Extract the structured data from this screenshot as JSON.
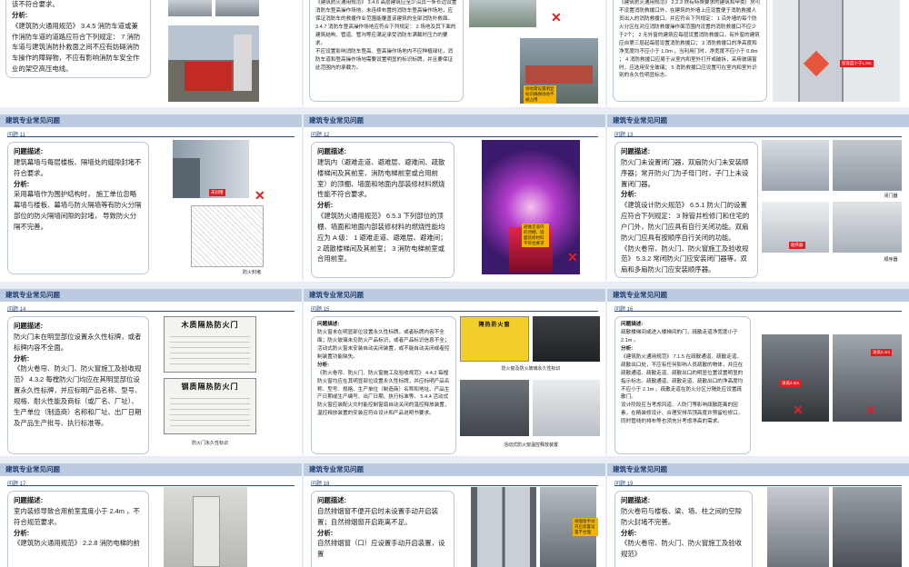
{
  "header": "建筑专业常见问题",
  "colors": {
    "band": "#bccbe0",
    "header_text": "#1f3f74",
    "card_border": "#b9c7dc",
    "x_mark": "#e02020"
  },
  "s1": {
    "l": [
      "该不符合要求。",
      "分析:"
    ]
  },
  "s2": {
    "p": "《建筑防火通用规范》 3.4.6 高层建筑应至少沿其一条长边设置消防车登高操作场地。未连续布置的消防车登高操作场地，应保证消防车的救援作业范围能覆盖该建筑的全部消防扑救面。 3.4.7 消防车登高操作场地应符合下列规定： 2 场地及其下面的建筑结构、管道、管沟等应满足承受消防车满载时压力的要求。",
    "p2": "不应设置影响消防车登高、登高操作场地内不应种植绿化，消防车道和登高操作场地需要设置明显的标识标牌，并且要保证此范围内的承载力。",
    "tag": "场地需设置明显标识确保场地不被占用",
    "x": "✕"
  },
  "s3": {
    "p": "《建筑防火通用规范》 2.2.3 除有特殊要求的建筑和甲类厂房可不设置消防救援口外，在建筑的外墙上应设置便于消防救援人员出入的消防救援口，并应符合下列规定： 1 沿外墙的每个防火分区在对应消防救援操作面范围内设置的消防救援口不应少于2个； 2 无外窗的建筑应每层设置消防救援口，有外窗的建筑应自第三层起每层设置消防救援口； 3 消防救援口的净高度和净宽度均不应小于 1.0m ，当利用门时，净宽度不应小于 0.8m ； 4 消防救援口应易于从室内和室外打开或破拆，采用玻璃窗时，应选用安全玻璃； 5 消防救援口应设置可在室内和室外识别的永久性明显标志。",
    "tag": "窗宽度小于1.0m"
  },
  "s11": {
    "num": "问题 11",
    "lines": [
      {
        "c": "h",
        "t": "问题描述:"
      },
      {
        "c": "t",
        "t": "建筑幕墙与每层楼板、隔墙处的缝隙封堵不符合要求。"
      },
      {
        "c": "h",
        "t": "分析:"
      },
      {
        "c": "t",
        "t": "采用幕墙作为围护结构时， 施工单位忽略幕墙与楼板、幕墙与防火隔墙等有防火分隔部位的防火隔墙间隙的封堵， 导致防火分隔不完善。"
      }
    ],
    "tag": "未封堵",
    "x": "✕",
    "cap": "防火封堵"
  },
  "s12": {
    "num": "问题 12",
    "lines": [
      {
        "c": "h",
        "t": "问题描述:"
      },
      {
        "c": "t",
        "t": "建筑内（避难走道、避难层、避难间、疏散楼梯间及其前室、消防电梯前室或合用前室）的顶棚、墙面和地面内部装修材料燃烧性能不符合要求。"
      },
      {
        "c": "h",
        "t": "分析:"
      },
      {
        "c": "t",
        "t": "《建筑防火通用规范》 6.5.3 下列部位的顶棚、墙面和地面内部装修材料的燃烧性能均应为 A 级： 1 避难走道、避难层、避难间； 2 疏散楼梯间及其前室； 3 消防电梯前室或合用前室。"
      }
    ],
    "tag": "避难走道内的顶棚、墙面装修材料不符合要求",
    "x": "✕"
  },
  "s13": {
    "num": "问题 13",
    "lines": [
      {
        "c": "h",
        "t": "问题描述:"
      },
      {
        "c": "t",
        "t": "防火门未设置闭门器，双扇防火门未安装顺序器；常开防火门为子母门时，子门上未设置闭门器。"
      },
      {
        "c": "h",
        "t": "分析:"
      },
      {
        "c": "t",
        "t": "《建筑设计防火规范》 6.5.1 防火门的设置应符合下列规定： 3 除管井检修门和住宅的户门外，防火门应具有自行关闭功能。双扇防火门应具有按顺序自行关闭的功能。"
      },
      {
        "c": "t",
        "t": "《防火卷帘、防火门、防火窗施工及验收规范》 5.3.2 常闭防火门应安装闭门器等，双扇和多扇防火门应安装顺序器。"
      }
    ],
    "cap1": "闭门器",
    "cap2": "顺序器",
    "tag": "顺序器"
  },
  "s14": {
    "num": "问题 14",
    "lines": [
      {
        "c": "h",
        "t": "问题描述:"
      },
      {
        "c": "t",
        "t": "防火门未在明显部位设置永久性标牌，或者标牌内容不全面。"
      },
      {
        "c": "h",
        "t": "分析:"
      },
      {
        "c": "t",
        "t": "《防火卷帘、防火门、防火窗施工及验收规范》 4.3.2 每樘防火门均应在其明显部位设置永久性标牌，并应标明产品名称、型号、规格、耐火性能及商标（或厂名、厂址）、生产单位（制造商）名称和厂址、出厂日期及产品生产批号、执行标准等。"
      }
    ],
    "plate1": "木质隔热防火门",
    "plate2": "钢质隔热防火门",
    "cap": "防火门永久性标识"
  },
  "s15": {
    "num": "问题 15",
    "lines": [
      {
        "c": "h",
        "t": "问题描述:"
      },
      {
        "c": "t",
        "t": "防火窗未在明显部位设置永久性标牌，或者标牌内容不全面；防火玻璃未见防火产品标识，或者产品标识信息不全；活动式防火窗未安装自动关闭装置，或不能自动关闭或者控制装置功能缺失。"
      },
      {
        "c": "h",
        "t": "分析:"
      },
      {
        "c": "t",
        "t": "《防火卷帘、防火门、防火窗施工及验收规范》 4.4.2 每樘防火窗均应在其明显部位设置永久性标牌，并应标明产品名称、型号、规格、生产单位（制造商）名称和地址、产品生产日期或生产编号、出厂日期、执行标准等。 5.4.4 活动式防火窗应装配火灾时能控制窗扇自动关闭的温控释放装置，温控释放装置的安装应符合设计和产品说明书要求。"
      }
    ],
    "cap1": "防火窗及防火玻璃永久性标识",
    "plate": "隔热防火窗",
    "cap2": "活动式防火窗温控释放装置"
  },
  "s16": {
    "num": "问题 16",
    "lines": [
      {
        "c": "h",
        "t": "问题描述:"
      },
      {
        "c": "t",
        "t": "疏散楼梯间或进入楼梯间的门，疏散走道净宽度小于 2.1m 。"
      },
      {
        "c": "h",
        "t": "分析:"
      },
      {
        "c": "t",
        "t": "《建筑防火通用规范》 7.1.5 在疏散通道、疏散走道、疏散出口处，不应有任何影响人员疏散的物体，并应在疏散通道、疏散走道、疏散出口的明显位置设置明显的指示标志。疏散通道、疏散走道、疏散出口的净高度均不应小于 2.1m 。疏散走道在防火分区分隔处应设置疏散门。"
      },
      {
        "c": "t",
        "t": "设计阶段应当考虑风道、人防门等影响疏散距离的因素，在精装修设计、合理安排吊顶高度并预留检修口，同时管线的排布等也须充分考虑净高的需求。"
      }
    ],
    "tag1": "净高2.0m",
    "tag2": "净高2.1m"
  },
  "s17": {
    "num": "问题 17",
    "lines": [
      {
        "c": "h",
        "t": "问题描述:"
      },
      {
        "c": "t",
        "t": "室内装修导致合用前室宽度小于 2.4m ，不符合规范要求。"
      },
      {
        "c": "h",
        "t": "分析:"
      },
      {
        "c": "t",
        "t": "《建筑防火通用规范》 2.2.8 消防电梯的前"
      }
    ]
  },
  "s18": {
    "num": "问题 18",
    "lines": [
      {
        "c": "h",
        "t": "问题描述:"
      },
      {
        "c": "t",
        "t": "自然排烟窗不便开启时未设置手动开启装置；自然排烟窗开启距离不足。"
      },
      {
        "c": "h",
        "t": "分析:"
      },
      {
        "c": "t",
        "t": "自然排烟窗（口）应设置手动开启装置，设置"
      }
    ],
    "tag": "排烟窗手动开启装置设置不合理"
  },
  "s19": {
    "num": "问题 19",
    "lines": [
      {
        "c": "h",
        "t": "问题描述:"
      },
      {
        "c": "t",
        "t": "防火卷帘与楼板、梁、墙、柱之间的空隙防火封堵不完善。"
      },
      {
        "c": "h",
        "t": "分析:"
      },
      {
        "c": "t",
        "t": "《防火卷帘、防火门、防火窗施工及验收规范》"
      }
    ]
  }
}
